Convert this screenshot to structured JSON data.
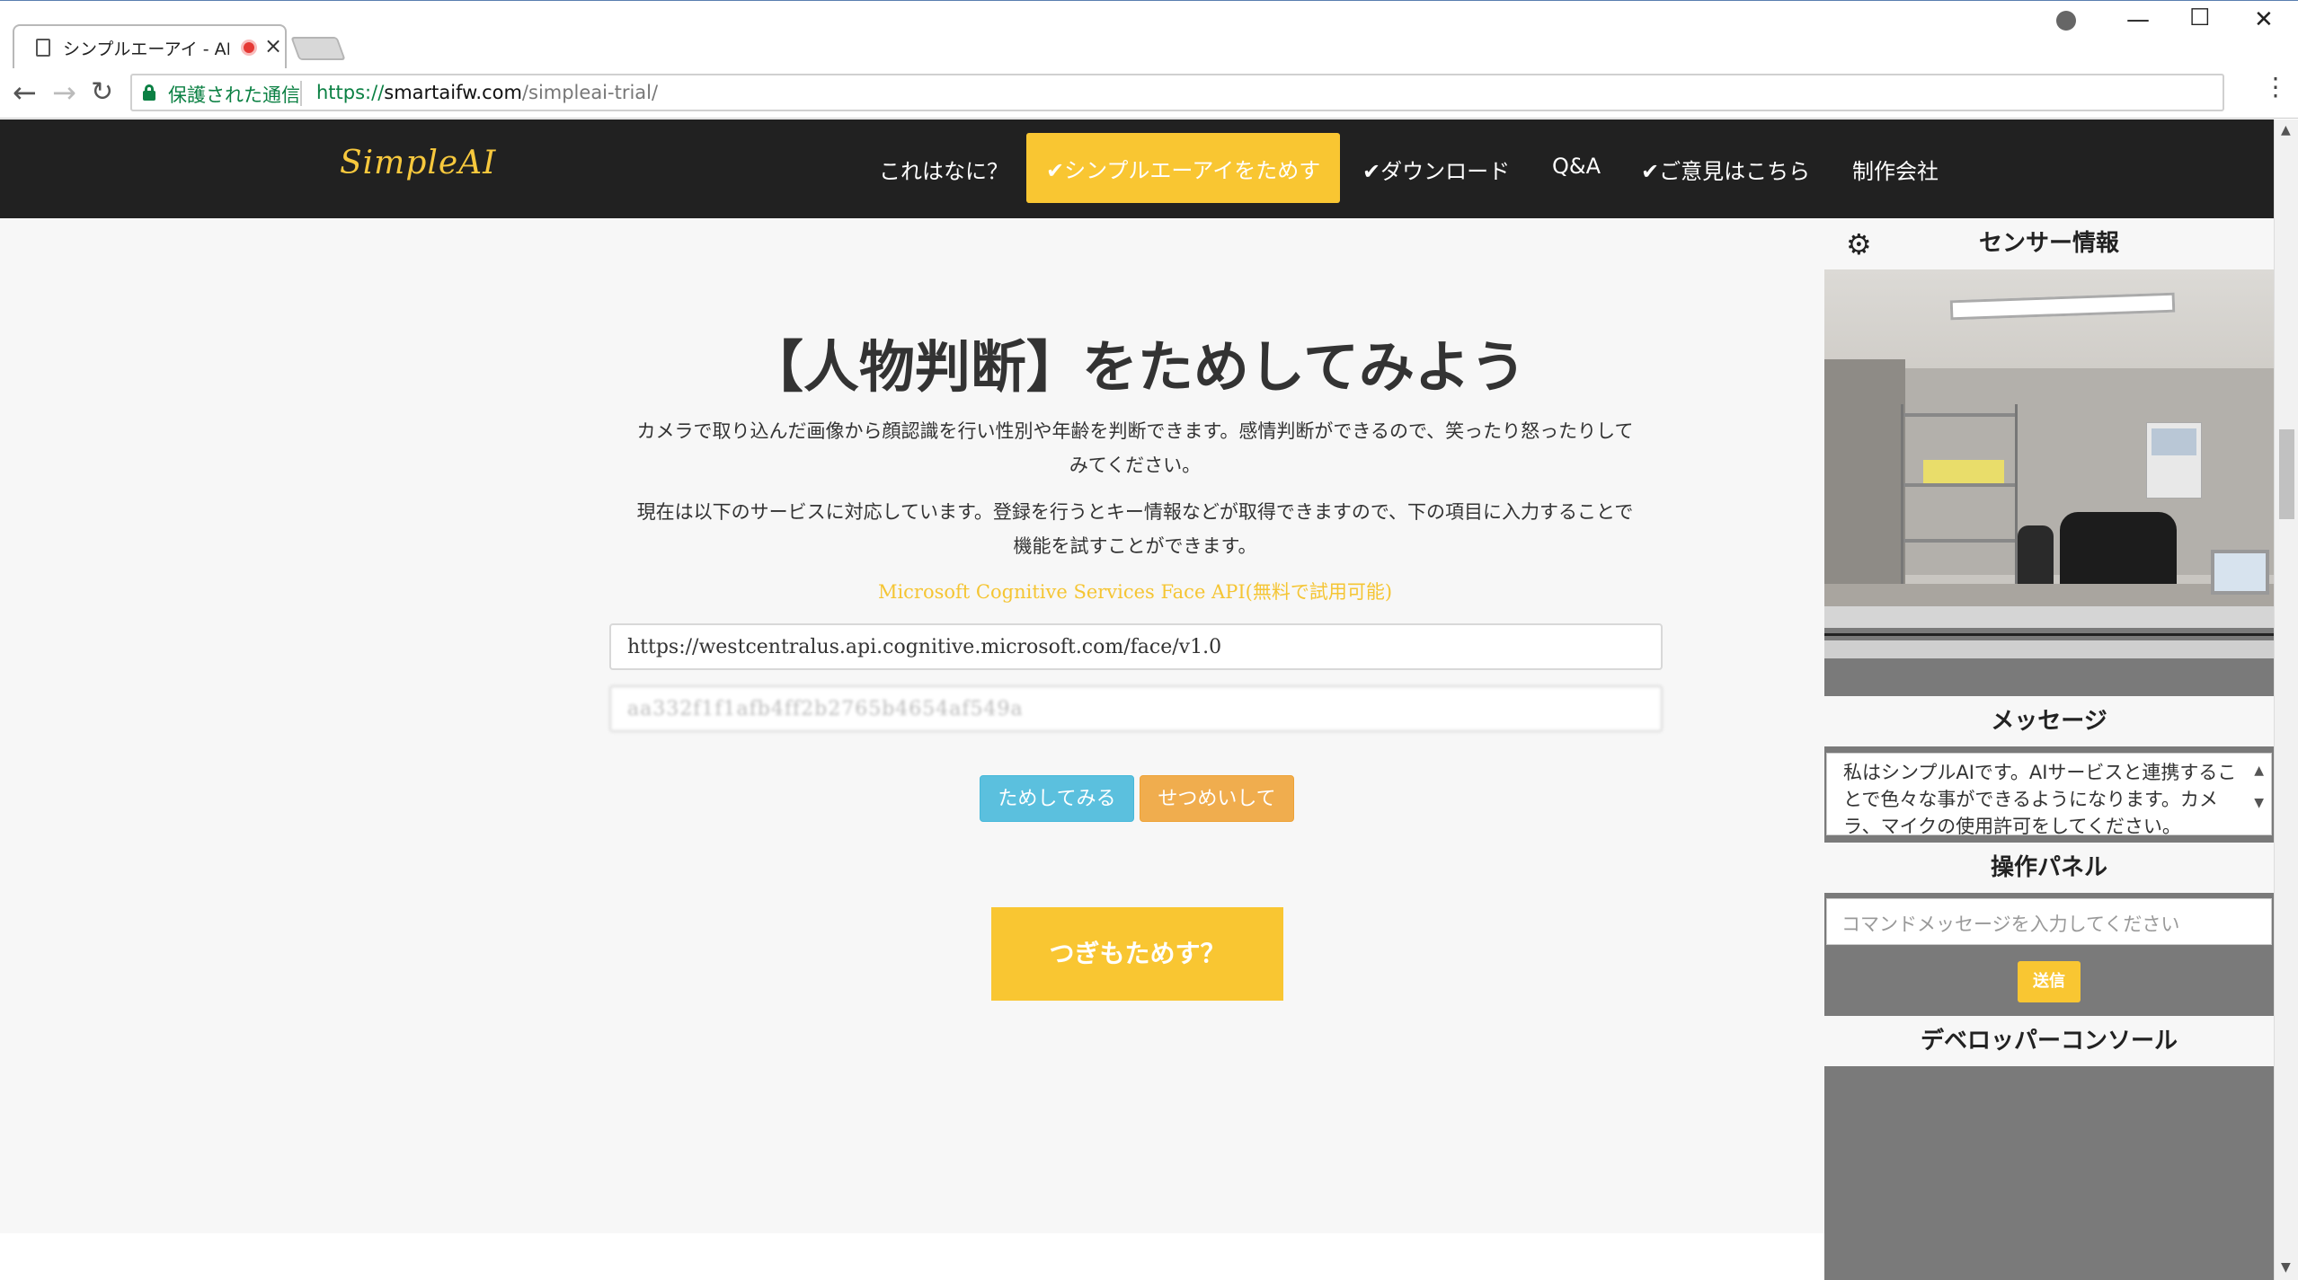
{
  "browser": {
    "tab_title": "シンプルエーアイ - AI利用",
    "secure_label": "保護された通信",
    "url_scheme": "https://",
    "url_host": "smartaifw.com",
    "url_path": "/simpleai-trial/"
  },
  "site": {
    "logo": "SimpleAI",
    "nav": [
      {
        "label": "これはなに？"
      },
      {
        "label": "✔シンプルエーアイをためす"
      },
      {
        "label": "✔ダウンロード"
      },
      {
        "label": "Q&A"
      },
      {
        "label": "✔ご意見はこちら"
      },
      {
        "label": "制作会社"
      }
    ]
  },
  "main": {
    "heading": "【人物判断】をためしてみよう",
    "desc1_line1": "カメラで取り込んだ画像から顔認識を行い性別や年齢を判断できます。感情判断ができるので、笑ったり怒ったりして",
    "desc1_line2": "みてください。",
    "desc2_line1": "現在は以下のサービスに対応しています。登録を行うとキー情報などが取得できますので、下の項目に入力することで",
    "desc2_line2": "機能を試すことができます。",
    "service_link": "Microsoft Cognitive Services Face API(無料で試用可能)",
    "endpoint_value": "https://westcentralus.api.cognitive.microsoft.com/face/v1.0",
    "key_value": "aa332f1f1afb4ff2b2765b4654af549a",
    "try_button": "ためしてみる",
    "explain_button": "せつめいして",
    "next_button": "つぎもためす？"
  },
  "panel": {
    "sensor_title": "センサー情報",
    "message_title": "メッセージ",
    "message_text": "私はシンプルAIです。AIサービスと連携することで色々な事ができるようになります。カメラ、マイクの使用許可をしてください。",
    "operation_title": "操作パネル",
    "command_placeholder": "コマンドメッセージを入力してください",
    "send_button": "送信",
    "console_title": "デベロッパーコンソール"
  },
  "colors": {
    "accent": "#f9c632",
    "header_bg": "#212121",
    "info_button": "#5bc0de",
    "warning_button": "#f0ad4e",
    "secure_green": "#0b8043"
  }
}
